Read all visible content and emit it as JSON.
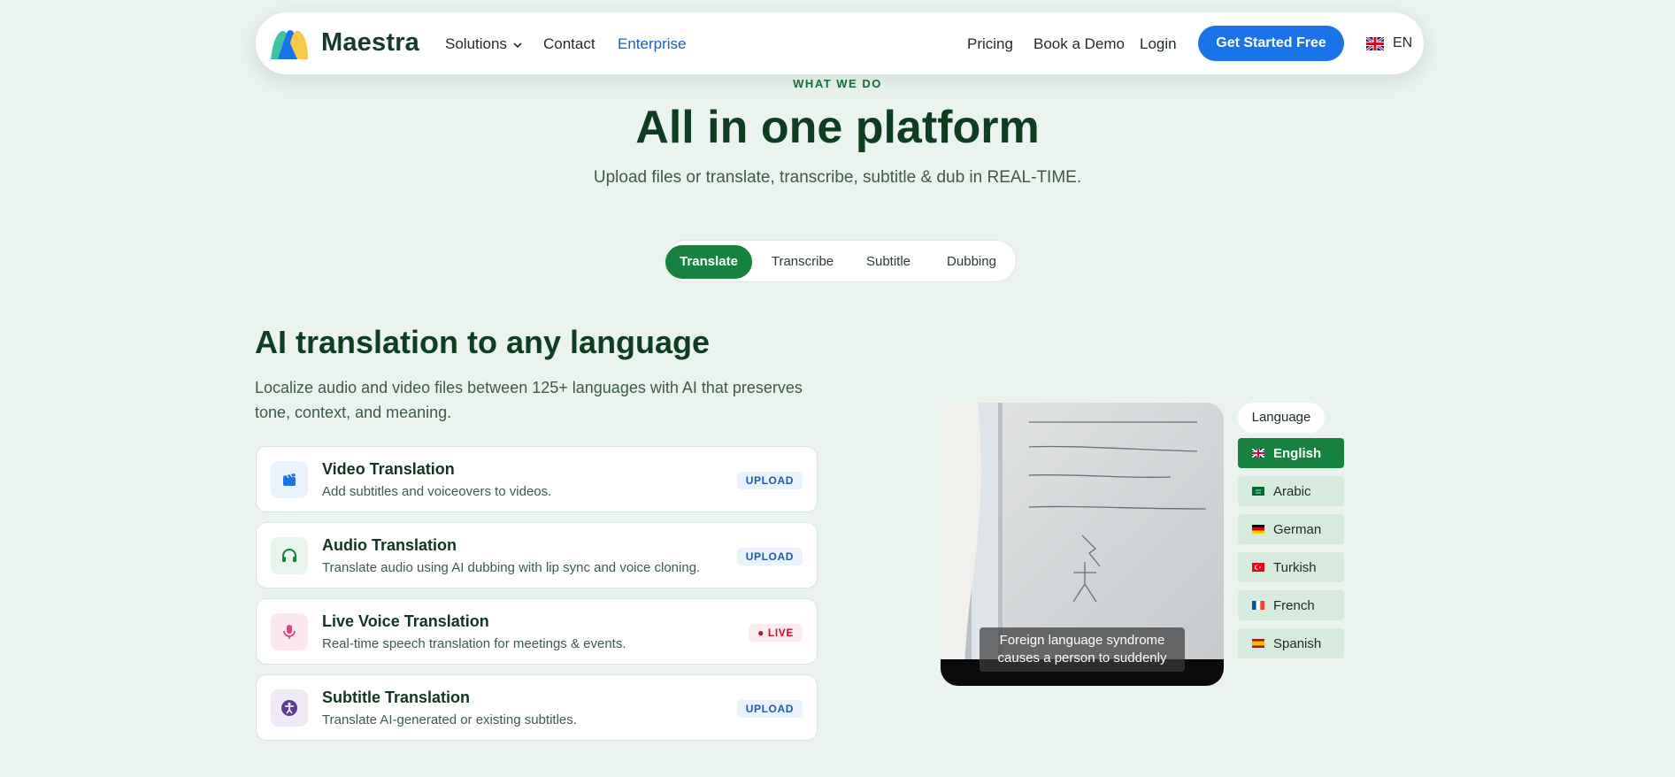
{
  "nav": {
    "brand": "Maestra",
    "links": [
      {
        "label": "Solutions"
      },
      {
        "label": "Contact"
      },
      {
        "label": "Enterprise"
      }
    ],
    "right_links": [
      {
        "label": "Pricing"
      },
      {
        "label": "Book a Demo"
      },
      {
        "label": "Login"
      }
    ],
    "cta_label": "Get Started Free",
    "language_code": "EN",
    "accent_color": "#1a73e8"
  },
  "hero": {
    "eyebrow": "WHAT WE DO",
    "title": "All in one platform",
    "subtitle": "Upload files or translate, transcribe, subtitle & dub in REAL-TIME."
  },
  "tabs": [
    {
      "label": "Translate",
      "active": true
    },
    {
      "label": "Transcribe",
      "active": false
    },
    {
      "label": "Subtitle",
      "active": false
    },
    {
      "label": "Dubbing",
      "active": false
    }
  ],
  "section": {
    "title": "AI translation to any language",
    "description": "Localize audio and video files between 125+ languages with AI that preserves tone, context, and meaning."
  },
  "cards": [
    {
      "title": "Video Translation",
      "subtitle": "Add subtitles and voiceovers to videos.",
      "badge": "UPLOAD",
      "icon": "clapperboard-icon"
    },
    {
      "title": "Audio Translation",
      "subtitle": "Translate audio using AI dubbing with lip sync and voice cloning.",
      "badge": "UPLOAD",
      "icon": "headphones-icon"
    },
    {
      "title": "Live Voice Translation",
      "subtitle": "Real-time speech translation for meetings & events.",
      "badge": "● LIVE",
      "icon": "microphone-icon"
    },
    {
      "title": "Subtitle Translation",
      "subtitle": "Translate AI-generated or existing subtitles.",
      "badge": "UPLOAD",
      "icon": "accessibility-icon"
    }
  ],
  "video": {
    "caption_line1": "Foreign language syndrome",
    "caption_line2": "causes a person to suddenly"
  },
  "language_panel": {
    "header": "Language",
    "items": [
      {
        "label": "English",
        "active": true
      },
      {
        "label": "Arabic",
        "active": false
      },
      {
        "label": "German",
        "active": false
      },
      {
        "label": "Turkish",
        "active": false
      },
      {
        "label": "French",
        "active": false
      },
      {
        "label": "Spanish",
        "active": false
      }
    ]
  },
  "colors": {
    "primary_green": "#16823f",
    "page_background": "#eaf3ee",
    "live_red": "#c8102e"
  }
}
